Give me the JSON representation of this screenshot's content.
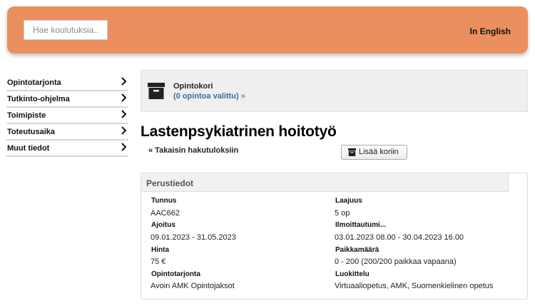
{
  "header": {
    "search_placeholder": "Hae koulutuksia...",
    "language_link": "In English",
    "accent_color": "#ec8f5e"
  },
  "sidebar": {
    "items": [
      {
        "label": "Opintotarjonta",
        "icon": "chevron-right-icon"
      },
      {
        "label": "Tutkinto-ohjelma",
        "icon": "chevron-right-icon"
      },
      {
        "label": "Toimipiste",
        "icon": "chevron-right-icon"
      },
      {
        "label": "Toteutusaika",
        "icon": "chevron-right-icon"
      },
      {
        "label": "Muut tiedot",
        "icon": "chevron-right-icon"
      }
    ]
  },
  "cart": {
    "icon": "archive-box-icon",
    "title": "Opintokori",
    "link_text": "(0 opintoa valittu)",
    "link_arrow": "»"
  },
  "course": {
    "title": "Lastenpsykiatrinen hoitotyö",
    "back_link": "« Takaisin hakutuloksiin",
    "add_button": "Lisää koriin",
    "add_button_icon": "archive-box-icon"
  },
  "details": {
    "heading": "Perustiedot",
    "fields": [
      {
        "label": "Tunnus",
        "value": "AAC662"
      },
      {
        "label": "Laajuus",
        "value": "5 op"
      },
      {
        "label": "Ajoitus",
        "value": "09.01.2023 - 31.05.2023"
      },
      {
        "label": "Ilmoittautumi...",
        "value": "03.01.2023 08.00 - 30.04.2023 16.00"
      },
      {
        "label": "Hinta",
        "value": "75 €"
      },
      {
        "label": "Paikkamäärä",
        "value": "0 - 200 (200/200 paikkaa vapaana)"
      },
      {
        "label": "Opintotarjonta",
        "value": "Avoin AMK Opintojaksot"
      },
      {
        "label": "Luokittelu",
        "value": "Virtuaaliopetus, AMK, Suomenkielinen opetus"
      }
    ]
  }
}
